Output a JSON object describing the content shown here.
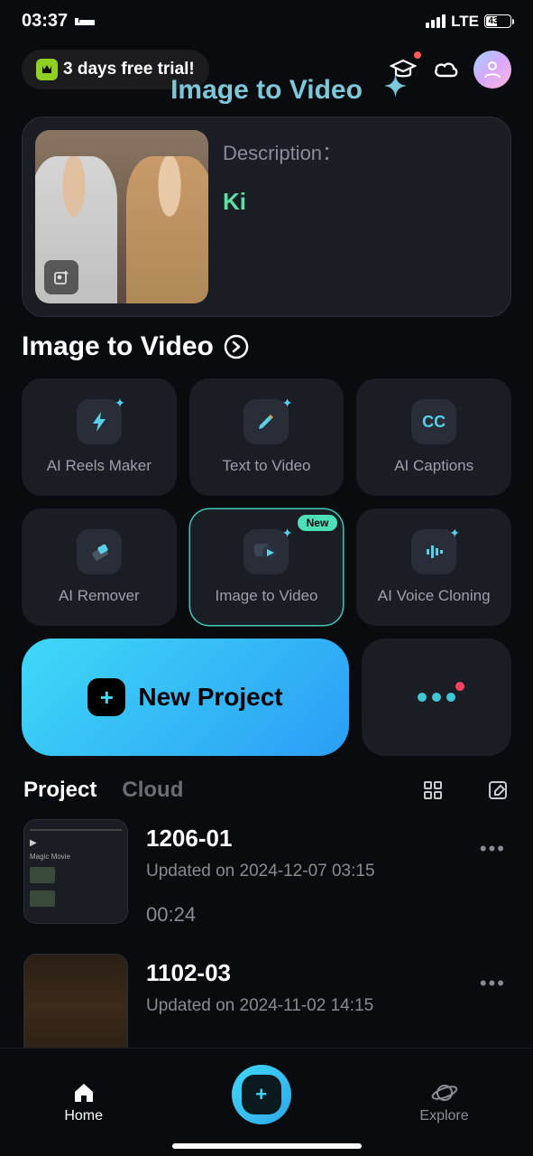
{
  "status": {
    "time": "03:37",
    "network": "LTE",
    "battery": "43"
  },
  "header": {
    "trial_text": "3 days free trial!"
  },
  "hero": {
    "title": "Image to Video",
    "desc_label": "Description：",
    "desc_text": "Ki"
  },
  "section": {
    "title": "Image to Video"
  },
  "tools": [
    {
      "label": "AI Reels Maker"
    },
    {
      "label": "Text  to Video"
    },
    {
      "label": "AI Captions",
      "cc": "CC"
    },
    {
      "label": "AI Remover"
    },
    {
      "label": "Image to Video",
      "badge": "New"
    },
    {
      "label": "AI Voice Cloning"
    }
  ],
  "new_project": {
    "label": "New Project"
  },
  "tabs": {
    "project": "Project",
    "cloud": "Cloud"
  },
  "projects": [
    {
      "name": "1206-01",
      "updated": "Updated on 2024-12-07 03:15",
      "duration": "00:24"
    },
    {
      "name": "1102-03",
      "updated": "Updated on 2024-11-02 14:15",
      "duration": ""
    }
  ],
  "nav": {
    "home": "Home",
    "explore": "Explore"
  }
}
